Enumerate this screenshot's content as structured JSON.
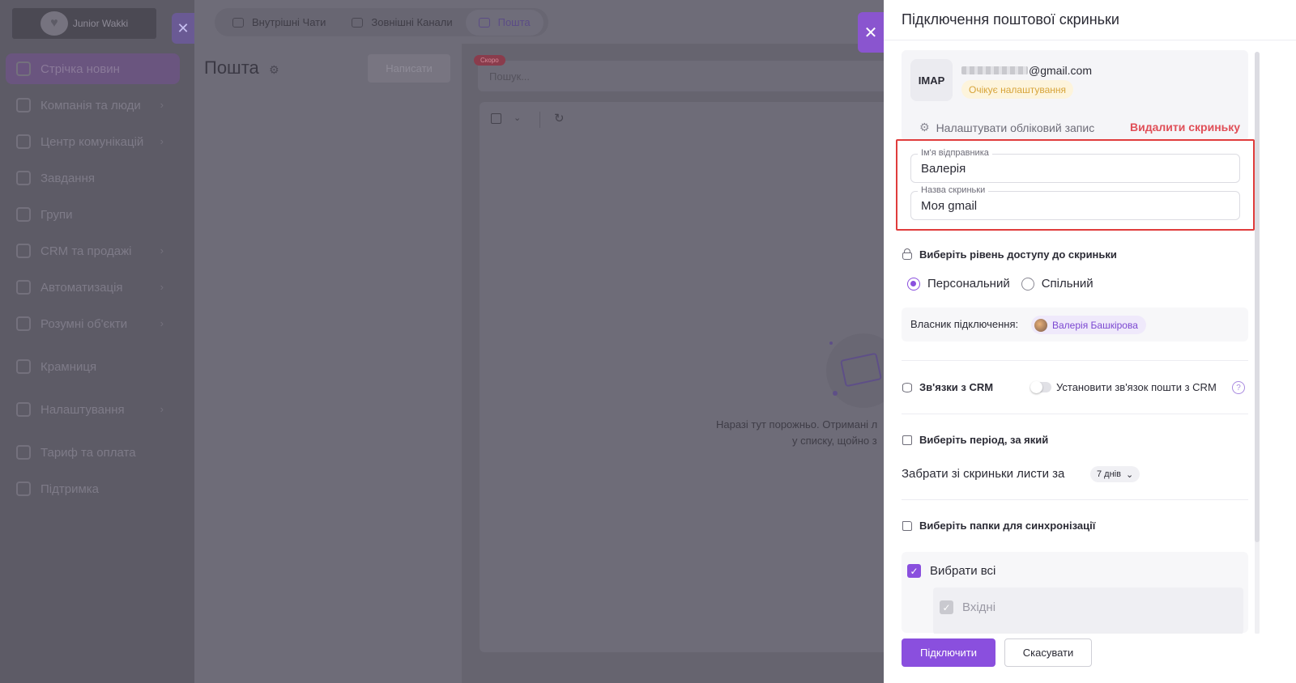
{
  "sidebar": {
    "logo_text": "Junior Wakki",
    "items": [
      {
        "label": "Стрічка новин",
        "active": true,
        "chevron": false
      },
      {
        "label": "Компанія та люди",
        "active": false,
        "chevron": true
      },
      {
        "label": "Центр комунікацій",
        "active": false,
        "chevron": true
      },
      {
        "label": "Завдання",
        "active": false,
        "chevron": false
      },
      {
        "label": "Групи",
        "active": false,
        "chevron": false
      },
      {
        "label": "CRM та продажі",
        "active": false,
        "chevron": true
      },
      {
        "label": "Автоматизація",
        "active": false,
        "chevron": true
      },
      {
        "label": "Розумні об'єкти",
        "active": false,
        "chevron": true
      },
      {
        "label": "Крамниця",
        "active": false,
        "chevron": false
      },
      {
        "label": "Налаштування",
        "active": false,
        "chevron": true
      },
      {
        "label": "Тариф та оплата",
        "active": false,
        "chevron": false
      },
      {
        "label": "Підтримка",
        "active": false,
        "chevron": false
      }
    ]
  },
  "topbar": {
    "tabs": [
      {
        "label": "Внутрішні Чати",
        "icon": "chat-icon"
      },
      {
        "label": "Зовнішні Канали",
        "icon": "channels-icon"
      },
      {
        "label": "Пошта",
        "icon": "mail-icon",
        "active": true
      }
    ]
  },
  "mail": {
    "title": "Пошта",
    "write_button": "Написати",
    "search_placeholder": "Пошук...",
    "soon_badge": "Скоро",
    "empty_line1": "Наразі тут порожньо. Отримані л",
    "empty_line2": "у списку, щойно з"
  },
  "panel": {
    "title": "Підключення поштової скриньки",
    "account": {
      "protocol": "IMAP",
      "email_suffix": "@gmail.com",
      "status": "Очікує налаштування",
      "settings_link": "Налаштувати обліковий запис",
      "delete_link": "Видалити скриньку"
    },
    "fields": {
      "sender_label": "Ім'я відправника",
      "sender_value": "Валерія",
      "box_label": "Назва скриньки",
      "box_value": "Моя gmail"
    },
    "access": {
      "heading": "Виберіть рівень доступу до скриньки",
      "option_personal": "Персональний",
      "option_shared": "Спільний",
      "selected": "personal",
      "owner_label": "Власник підключення:",
      "owner_name": "Валерія Башкірова"
    },
    "crm": {
      "heading": "Зв'язки з CRM",
      "toggle_label": "Установити зв'язок пошти з CRM",
      "enabled": false,
      "help": "?"
    },
    "period": {
      "heading": "Виберіть період, за який",
      "label": "Забрати зі скриньки листи за",
      "value": "7 днів"
    },
    "folders": {
      "heading": "Виберіть папки для синхронізації",
      "select_all": "Вибрати всі",
      "items": [
        "Вхідні"
      ]
    },
    "footer": {
      "connect": "Підключити",
      "cancel": "Скасувати"
    }
  },
  "colors": {
    "accent": "#8a4fde",
    "danger": "#e04f58",
    "highlight_frame": "#e03c3c",
    "warning_text": "#d7a43a"
  }
}
